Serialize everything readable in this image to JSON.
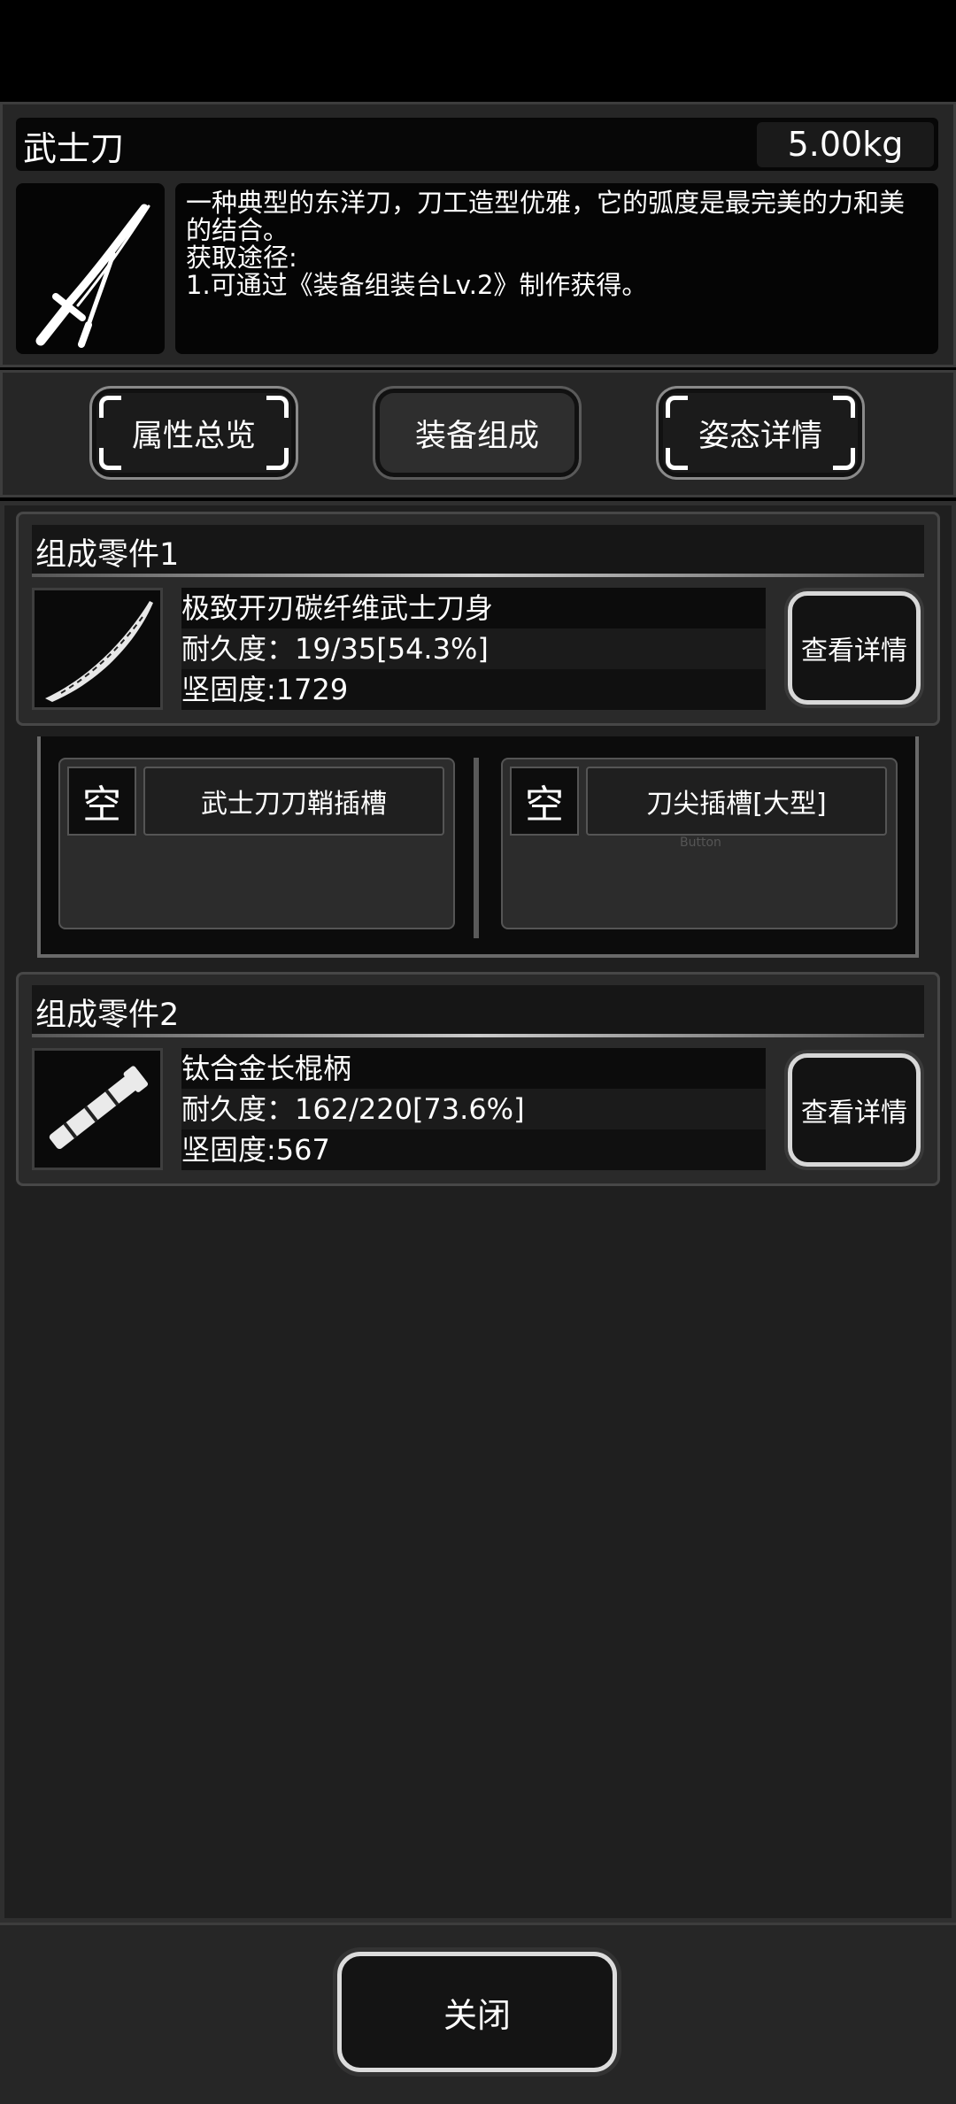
{
  "item": {
    "name": "武士刀",
    "weight": "5.00kg",
    "icon": "katana-icon",
    "description_lines": [
      "一种典型的东洋刀，刀工造型优雅，它的弧度是最完美的力和美",
      "的结合。",
      "获取途径:",
      "1.可通过《装备组装台Lv.2》制作获得。"
    ]
  },
  "tabs": [
    {
      "label": "属性总览",
      "active": false
    },
    {
      "label": "装备组成",
      "active": true
    },
    {
      "label": "姿态详情",
      "active": false
    }
  ],
  "parts": [
    {
      "title": "组成零件1",
      "name": "极致开刃碳纤维武士刀身",
      "durability": "耐久度：19/35[54.3%]",
      "hardness": "坚固度:1729",
      "detail_label": "查看详情",
      "icon": "blade-icon"
    },
    {
      "title": "组成零件2",
      "name": "钛合金长棍柄",
      "durability": "耐久度：162/220[73.6%]",
      "hardness": "坚固度:567",
      "detail_label": "查看详情",
      "icon": "handle-icon"
    }
  ],
  "slots": [
    {
      "empty_label": "空",
      "name": "武士刀刀鞘插槽"
    },
    {
      "empty_label": "空",
      "name": "刀尖插槽[大型]",
      "hint": "Button"
    }
  ],
  "close_label": "关闭"
}
